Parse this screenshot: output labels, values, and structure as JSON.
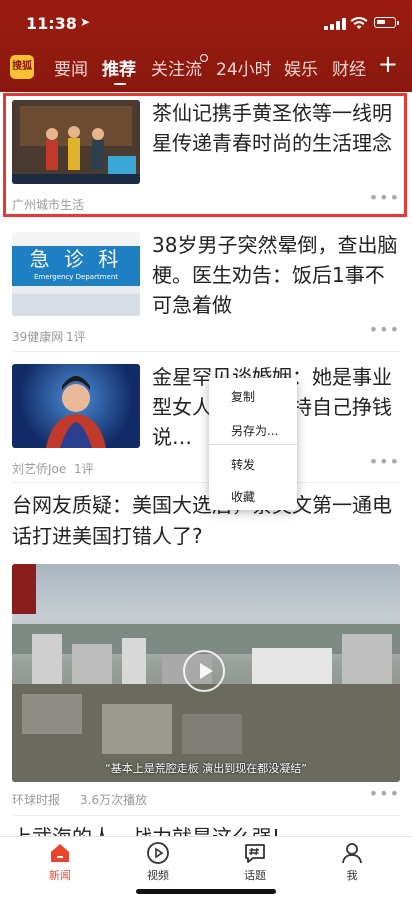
{
  "status": {
    "time": "11:38"
  },
  "nav": {
    "logo_text": "搜狐",
    "tabs": [
      {
        "label": "要闻"
      },
      {
        "label": "推荐"
      },
      {
        "label": "关注流"
      },
      {
        "label": "24小时"
      },
      {
        "label": "娱乐"
      },
      {
        "label": "财经"
      }
    ],
    "active_tab": "推荐"
  },
  "feed": [
    {
      "title": "茶仙记携手黄圣依等一线明星传递青春时尚的生活理念",
      "source": "广州城市生活",
      "comments": ""
    },
    {
      "title": "38岁男子突然晕倒，查出脑梗。医生劝告：饭后1事不可急着做",
      "source": "39健康网",
      "comments": "1评",
      "thumb_text": "急 诊 科",
      "thumb_subtext": "Emergency Department"
    },
    {
      "title": "金星罕见谈婚姻：她是事业型女人，因为坚持自己挣钱说…",
      "source": "刘艺侨Joe",
      "comments": "1评"
    },
    {
      "title": "台网友质疑：美国大选后，蔡英文第一通电话打进美国打错人了?",
      "source": "环球时报",
      "plays": "3.6万次播放",
      "video_caption": "“基本上是荒腔走板 演出到现在都没凝结”"
    },
    {
      "title": "上武海的人，战力就是这么强!"
    }
  ],
  "context_menu": {
    "items": [
      "复制",
      "另存为...",
      "转发",
      "收藏"
    ]
  },
  "bottom_nav": [
    {
      "label": "新闻",
      "active": true
    },
    {
      "label": "视频"
    },
    {
      "label": "话题"
    },
    {
      "label": "我"
    }
  ],
  "colors": {
    "brand": "#8a180e",
    "active_bottom": "#e8462c",
    "highlight": "#e53935"
  }
}
